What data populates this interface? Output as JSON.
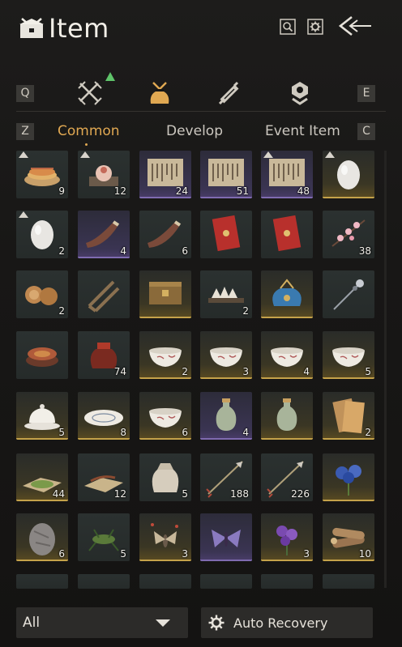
{
  "header": {
    "title": "Item",
    "title_icon": "item-chest-icon",
    "buttons": [
      {
        "name": "search-button",
        "icon": "search-icon"
      },
      {
        "name": "settings-button",
        "icon": "gear-icon"
      },
      {
        "name": "back-button",
        "icon": "back-arrow-icon"
      }
    ]
  },
  "category_tabs": {
    "prev_key": "Q",
    "next_key": "E",
    "tabs": [
      {
        "name": "weapons",
        "icon": "crossed-swords-icon",
        "has_new": true
      },
      {
        "name": "bundle",
        "icon": "pouch-icon",
        "active": true
      },
      {
        "name": "scrolls",
        "icon": "scroll-icon"
      },
      {
        "name": "misc",
        "icon": "emblem-icon"
      }
    ]
  },
  "sub_tabs": {
    "prev_key": "Z",
    "next_key": "C",
    "tabs": [
      {
        "label": "Common",
        "active": true
      },
      {
        "label": "Develop",
        "active": false
      },
      {
        "label": "Event Item",
        "active": false
      }
    ]
  },
  "items": [
    {
      "icon": "pancake-plate-icon",
      "count": "9",
      "rarity": "common",
      "badge": true
    },
    {
      "icon": "stuffed-bun-icon",
      "count": "12",
      "rarity": "common",
      "badge": true
    },
    {
      "icon": "letter-scroll-icon",
      "count": "24",
      "rarity": "purple"
    },
    {
      "icon": "letter-scroll-icon",
      "count": "51",
      "rarity": "purple"
    },
    {
      "icon": "letter-scroll-icon",
      "count": "48",
      "rarity": "purple",
      "badge": true
    },
    {
      "icon": "egg-icon",
      "count": "",
      "rarity": "gold",
      "badge": true
    },
    {
      "icon": "egg-icon",
      "count": "2",
      "rarity": "common",
      "badge": true
    },
    {
      "icon": "horn-icon",
      "count": "4",
      "rarity": "purple"
    },
    {
      "icon": "horn-icon",
      "count": "6",
      "rarity": "common"
    },
    {
      "icon": "red-envelope-icon",
      "count": "",
      "rarity": "common"
    },
    {
      "icon": "red-envelope-icon",
      "count": "",
      "rarity": "common"
    },
    {
      "icon": "blossom-branch-icon",
      "count": "38",
      "rarity": "common"
    },
    {
      "icon": "pastry-icon",
      "count": "2",
      "rarity": "common"
    },
    {
      "icon": "wood-tool-icon",
      "count": "",
      "rarity": "common"
    },
    {
      "icon": "wooden-box-icon",
      "count": "",
      "rarity": "gold"
    },
    {
      "icon": "dumplings-icon",
      "count": "2",
      "rarity": "common"
    },
    {
      "icon": "blue-pouch-icon",
      "count": "",
      "rarity": "gold"
    },
    {
      "icon": "hairpin-icon",
      "count": "",
      "rarity": "common"
    },
    {
      "icon": "lacquer-box-icon",
      "count": "",
      "rarity": "common"
    },
    {
      "icon": "wine-jar-icon",
      "count": "74",
      "rarity": "common"
    },
    {
      "icon": "porcelain-bowl-icon",
      "count": "2",
      "rarity": "gold"
    },
    {
      "icon": "porcelain-bowl-icon",
      "count": "3",
      "rarity": "gold"
    },
    {
      "icon": "porcelain-bowl-icon",
      "count": "4",
      "rarity": "gold"
    },
    {
      "icon": "porcelain-bowl-icon",
      "count": "5",
      "rarity": "gold"
    },
    {
      "icon": "covered-cup-icon",
      "count": "5",
      "rarity": "gold"
    },
    {
      "icon": "plate-icon",
      "count": "8",
      "rarity": "gold"
    },
    {
      "icon": "porcelain-bowl-icon",
      "count": "6",
      "rarity": "gold"
    },
    {
      "icon": "vase-icon",
      "count": "4",
      "rarity": "purple"
    },
    {
      "icon": "vase-icon",
      "count": "",
      "rarity": "gold"
    },
    {
      "icon": "book-icon",
      "count": "2",
      "rarity": "gold"
    },
    {
      "icon": "herb-powder-icon",
      "count": "44",
      "rarity": "gold"
    },
    {
      "icon": "dried-root-icon",
      "count": "12",
      "rarity": "common"
    },
    {
      "icon": "sack-icon",
      "count": "5",
      "rarity": "common"
    },
    {
      "icon": "arrow-icon",
      "count": "188",
      "rarity": "common"
    },
    {
      "icon": "arrow-icon",
      "count": "226",
      "rarity": "common"
    },
    {
      "icon": "blue-flower-icon",
      "count": "",
      "rarity": "gold"
    },
    {
      "icon": "stone-icon",
      "count": "6",
      "rarity": "gold"
    },
    {
      "icon": "cricket-icon",
      "count": "5",
      "rarity": "common"
    },
    {
      "icon": "moth-icon",
      "count": "3",
      "rarity": "gold"
    },
    {
      "icon": "butterfly-icon",
      "count": "",
      "rarity": "purple"
    },
    {
      "icon": "purple-flower-icon",
      "count": "3",
      "rarity": "gold"
    },
    {
      "icon": "firewood-icon",
      "count": "10",
      "rarity": "gold"
    }
  ],
  "footer": {
    "filter_label": "All",
    "auto_recovery_label": "Auto Recovery"
  },
  "colors": {
    "accent": "#e0a852",
    "gold_rarity": "#c4a24a",
    "purple_rarity": "#7f6bb0"
  }
}
